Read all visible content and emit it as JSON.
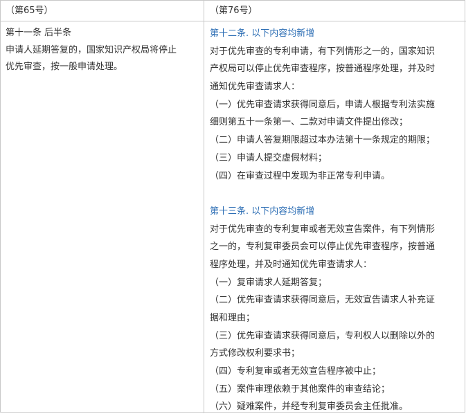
{
  "headers": {
    "left": "（第65号）",
    "right": "（第76号）"
  },
  "left": {
    "title": "第十一条 后半条",
    "lines": [
      "申请人延期答复的，国家知识产权局将停止",
      "优先审查，按一般申请处理。"
    ]
  },
  "right": {
    "sec12_title": "第十二条. 以下内容均新增",
    "sec12_lines": [
      "对于优先审查的专利申请，有下列情形之一的，国家知识",
      "产权局可以停止优先审查程序，按普通程序处理，并及时",
      "通知优先审查请求人：",
      "（一）优先审查请求获得同意后，申请人根据专利法实施",
      "细则第五十一条第一、二款对申请文件提出修改；",
      "（二）申请人答复期限超过本办法第十一条规定的期限；",
      "（三）申请人提交虚假材料；",
      "（四）在审查过程中发现为非正常专利申请。"
    ],
    "sec13_title": "第十三条. 以下内容均新增",
    "sec13_lines": [
      "对于优先审查的专利复审或者无效宣告案件，有下列情形",
      "之一的，专利复审委员会可以停止优先审查程序，按普通",
      "程序处理，并及时通知优先审查请求人：",
      "（一）复审请求人延期答复；",
      "（二）优先审查请求获得同意后，无效宣告请求人补充证",
      "据和理由；",
      "（三）优先审查请求获得同意后，专利权人以删除以外的",
      "方式修改权利要求书；",
      "（四）专利复审或者无效宣告程序被中止；",
      "（五）案件审理依赖于其他案件的审查结论；",
      "（六）疑难案件，并经专利复审委员会主任批准。"
    ]
  },
  "colors": {
    "accent": "#2b6db4",
    "text": "#333333",
    "border": "#c8c8c8"
  }
}
